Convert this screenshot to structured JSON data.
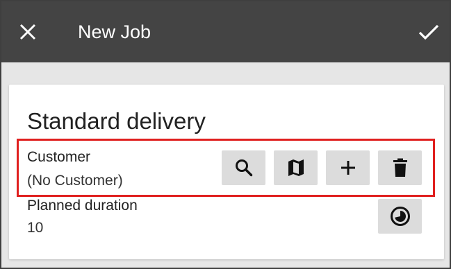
{
  "appbar": {
    "title": "New Job",
    "close_icon": "close-icon",
    "confirm_icon": "check-icon"
  },
  "card": {
    "title": "Standard delivery",
    "customer": {
      "label": "Customer",
      "value": "(No Customer)",
      "actions": [
        {
          "name": "search-customer-button",
          "icon": "search-icon"
        },
        {
          "name": "map-customer-button",
          "icon": "map-icon"
        },
        {
          "name": "add-customer-button",
          "icon": "plus-icon"
        },
        {
          "name": "delete-customer-button",
          "icon": "trash-icon"
        }
      ]
    },
    "duration": {
      "label": "Planned duration",
      "value": "10",
      "action_icon": "timer-icon"
    }
  },
  "colors": {
    "appbar_bg": "#444444",
    "page_bg": "#e6e6e6",
    "button_bg": "#dcdcdc",
    "highlight": "#e0201f"
  }
}
